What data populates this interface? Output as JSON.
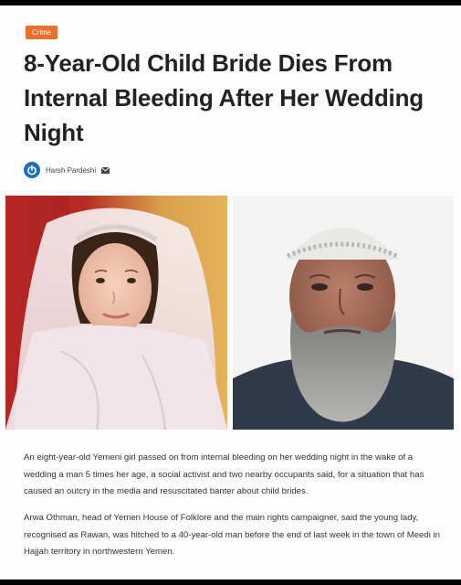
{
  "article": {
    "category": "Crime",
    "headline": "8-Year-Old Child Bride Dies From Internal Bleeding After Her Wedding Night",
    "author": "Harsh Pardeshi",
    "author_icon": "power-logo-icon",
    "mail_icon": "envelope-icon",
    "images": [
      {
        "name": "photo-child-bride"
      },
      {
        "name": "photo-older-man"
      }
    ],
    "paragraphs": [
      "An eight-year-old Yemeni girl passed on from internal bleeding on her wedding night in the wake of a wedding a man 5 times her age, a social activist and two nearby occupants said, for a situation that has caused an outcry in the media and resuscitated banter about child brides.",
      "Arwa Othman, head of Yemen House of Folklore and the main rights campaigner, said the young lady, recognised as Rawan, was hitched to a 40-year-old man before the end of last week in the town of Meedi in Hajjah territory in northwestern Yemen."
    ]
  },
  "colors": {
    "category_badge": "#e8702a",
    "author_logo": "#1e6fb8",
    "headline": "#222222",
    "body_text": "#333333"
  }
}
